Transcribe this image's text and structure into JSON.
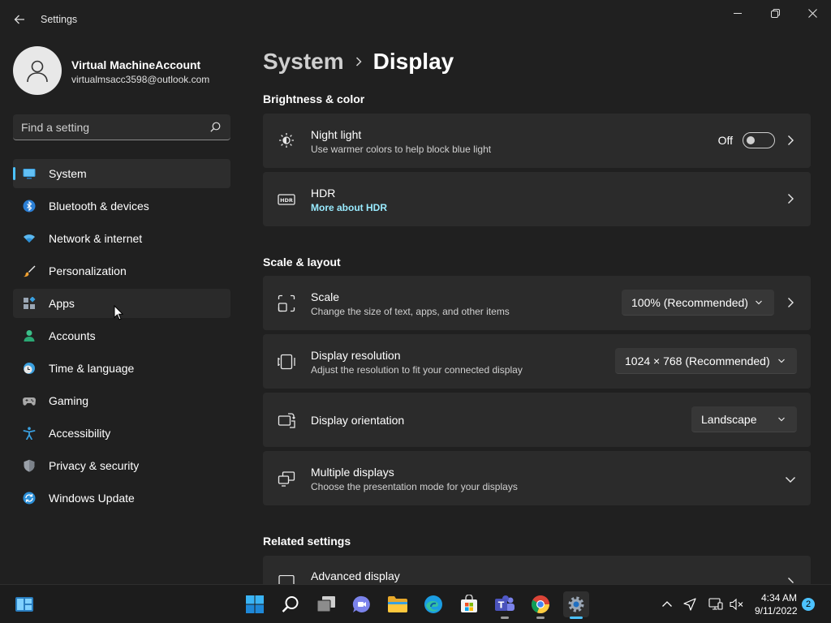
{
  "window": {
    "title": "Settings"
  },
  "account": {
    "name": "Virtual MachineAccount",
    "email": "virtualmsacc3598@outlook.com"
  },
  "search": {
    "placeholder": "Find a setting"
  },
  "nav": {
    "items": [
      {
        "label": "System",
        "icon": "monitor-icon",
        "selected": true
      },
      {
        "label": "Bluetooth & devices",
        "icon": "bluetooth-icon"
      },
      {
        "label": "Network & internet",
        "icon": "wifi-icon"
      },
      {
        "label": "Personalization",
        "icon": "brush-icon"
      },
      {
        "label": "Apps",
        "icon": "apps-icon",
        "hover": true
      },
      {
        "label": "Accounts",
        "icon": "person-icon"
      },
      {
        "label": "Time & language",
        "icon": "clock-globe-icon"
      },
      {
        "label": "Gaming",
        "icon": "gamepad-icon"
      },
      {
        "label": "Accessibility",
        "icon": "accessibility-icon"
      },
      {
        "label": "Privacy & security",
        "icon": "shield-icon"
      },
      {
        "label": "Windows Update",
        "icon": "update-icon"
      }
    ]
  },
  "breadcrumb": {
    "parent": "System",
    "current": "Display"
  },
  "sections": {
    "brightness": {
      "title": "Brightness & color",
      "night_light": {
        "title": "Night light",
        "subtitle": "Use warmer colors to help block blue light",
        "state": "Off"
      },
      "hdr": {
        "title": "HDR",
        "link": "More about HDR"
      }
    },
    "scale_layout": {
      "title": "Scale & layout",
      "scale": {
        "title": "Scale",
        "subtitle": "Change the size of text, apps, and other items",
        "value": "100% (Recommended)"
      },
      "resolution": {
        "title": "Display resolution",
        "subtitle": "Adjust the resolution to fit your connected display",
        "value": "1024 × 768 (Recommended)"
      },
      "orientation": {
        "title": "Display orientation",
        "value": "Landscape"
      },
      "multiple": {
        "title": "Multiple displays",
        "subtitle": "Choose the presentation mode for your displays"
      }
    },
    "related": {
      "title": "Related settings",
      "advanced": {
        "title": "Advanced display"
      }
    }
  },
  "taskbar": {
    "time": "4:34 AM",
    "date": "9/11/2022",
    "notifications": "2",
    "colors": {
      "accent": "#4cc2ff",
      "background": "#202020",
      "card": "#2b2b2b"
    }
  }
}
